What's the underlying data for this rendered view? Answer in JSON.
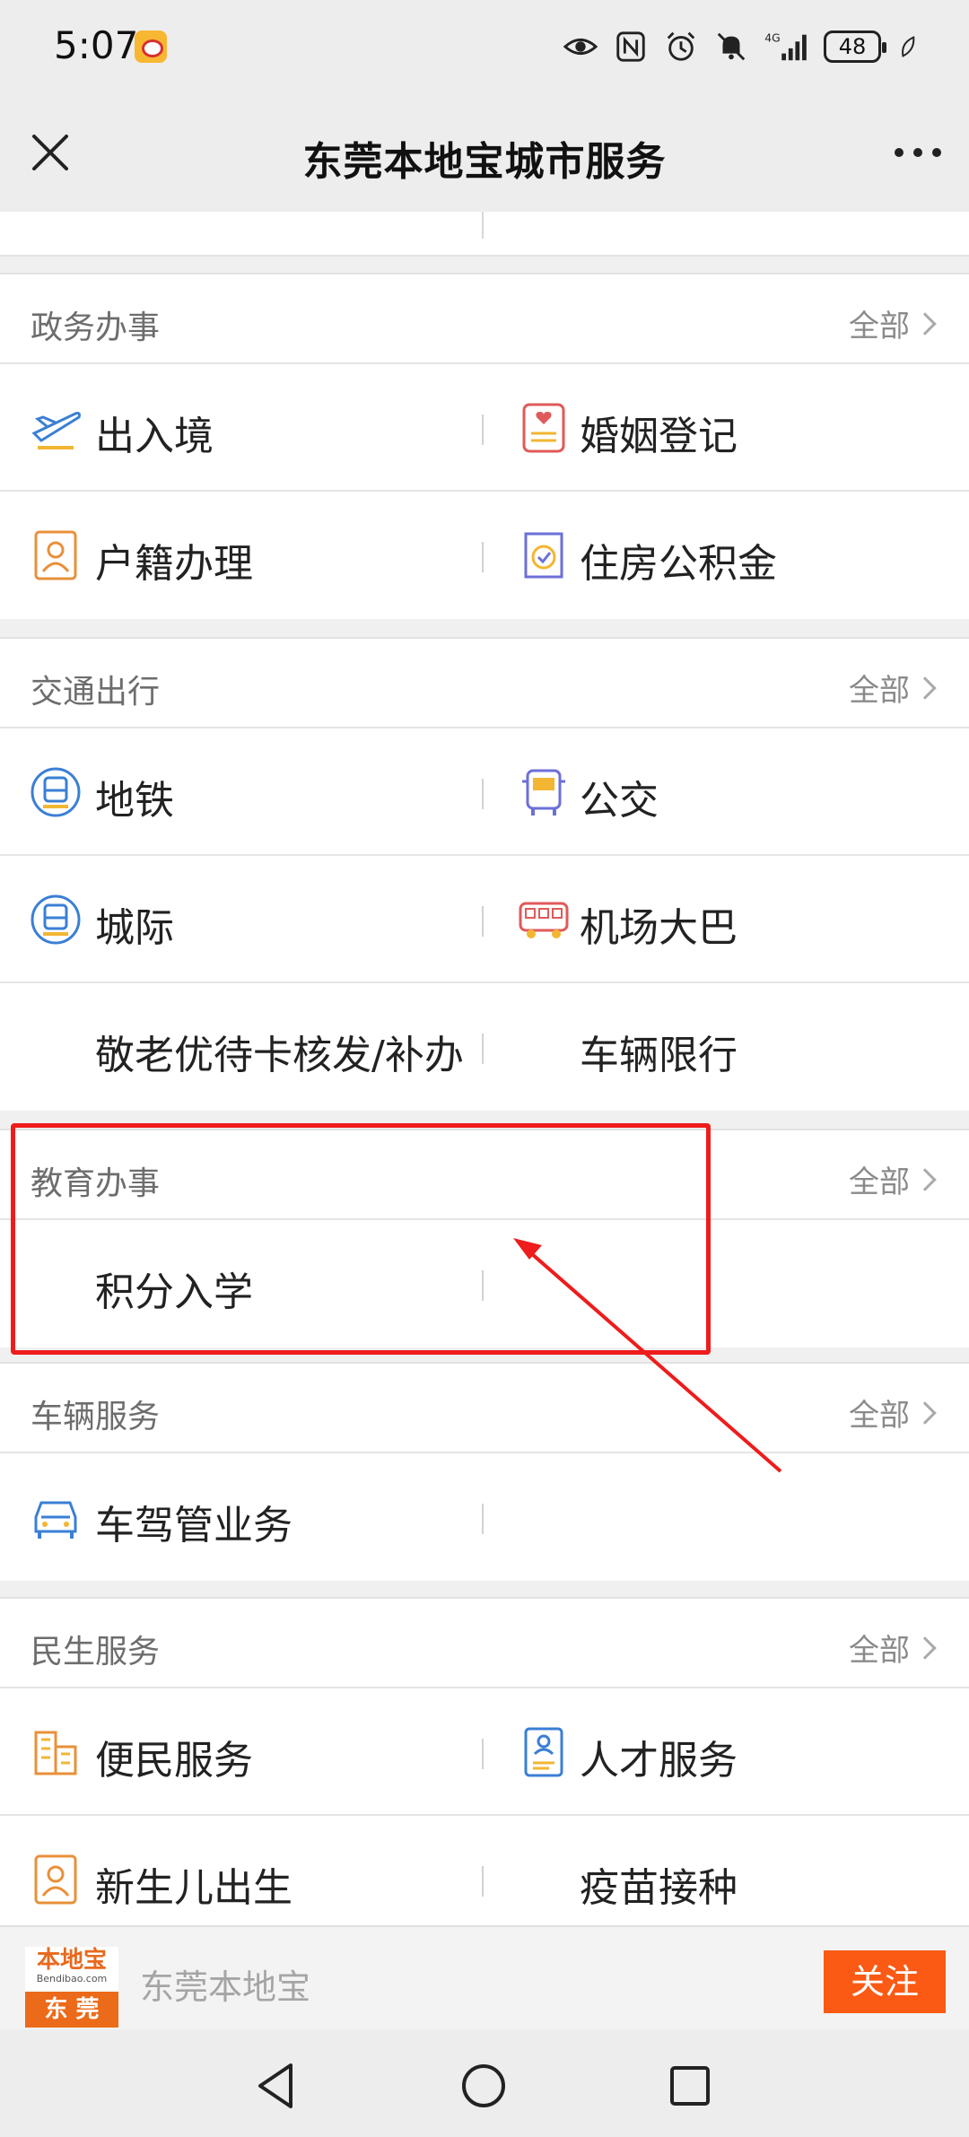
{
  "status": {
    "time": "5:07",
    "battery": "48",
    "network": "4G"
  },
  "nav": {
    "title": "东莞本地宝城市服务"
  },
  "sections": {
    "gov": {
      "title": "政务办事",
      "all": "全部",
      "items": [
        "出入境",
        "婚姻登记",
        "户籍办理",
        "住房公积金"
      ]
    },
    "traffic": {
      "title": "交通出行",
      "all": "全部",
      "items": [
        "地铁",
        "公交",
        "城际",
        "机场大巴",
        "敬老优待卡核发/补办",
        "车辆限行"
      ]
    },
    "edu": {
      "title": "教育办事",
      "all": "全部",
      "items": [
        "积分入学"
      ]
    },
    "vehicle": {
      "title": "车辆服务",
      "all": "全部",
      "items": [
        "车驾管业务"
      ]
    },
    "life": {
      "title": "民生服务",
      "all": "全部",
      "items": [
        "便民服务",
        "人才服务",
        "新生儿出生",
        "疫苗接种"
      ]
    }
  },
  "follow": {
    "logo_main": "本地宝",
    "logo_sub": "Bendibao.com",
    "logo_city": "东 莞",
    "name": "东莞本地宝",
    "button": "关注"
  },
  "colors": {
    "accent": "#fa5a14",
    "highlight": "#ee1c1c",
    "blue_icon": "#3a7fd5",
    "orange_icon": "#e8903a"
  }
}
